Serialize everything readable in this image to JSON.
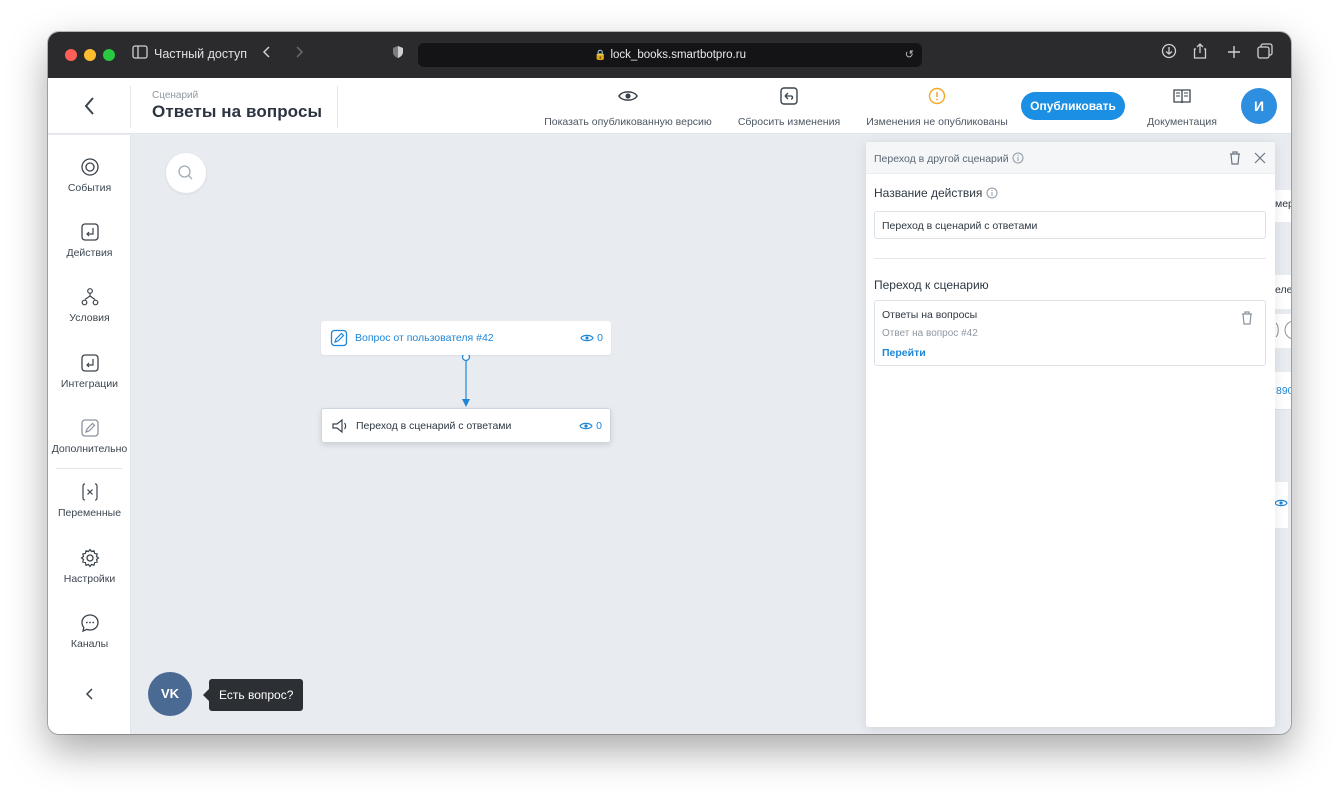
{
  "browser": {
    "tab_label": "Частный доступ",
    "url": "lock_books.smartbotpro.ru"
  },
  "header": {
    "scenario_caption": "Сценарий",
    "scenario_title": "Ответы на вопросы",
    "show_published_label": "Показать опубликованную версию",
    "reset_changes_label": "Сбросить изменения",
    "unpublished_label": "Изменения не опубликованы",
    "publish_label": "Опубликовать",
    "docs_label": "Документация",
    "avatar_initial": "И",
    "warning_color": "#f5a623",
    "accent_color": "#1a8fe3"
  },
  "sidebar": {
    "items": [
      {
        "label": "События",
        "icon": "target-icon"
      },
      {
        "label": "Действия",
        "icon": "action-icon"
      },
      {
        "label": "Условия",
        "icon": "branch-icon"
      },
      {
        "label": "Интеграции",
        "icon": "integration-icon"
      },
      {
        "label": "Дополнительно",
        "icon": "edit-icon"
      },
      {
        "label": "Переменные",
        "icon": "variable-icon"
      },
      {
        "label": "Настройки",
        "icon": "gear-icon"
      },
      {
        "label": "Каналы",
        "icon": "chat-icon"
      }
    ]
  },
  "canvas": {
    "nodes": [
      {
        "label": "Вопрос от пользователя #42",
        "views": "0"
      },
      {
        "label": "Переход в сценарий с ответами",
        "views": "0"
      }
    ],
    "help_tooltip": "Есть вопрос?",
    "vk_label": "VK",
    "peek": {
      "text_1": "мер",
      "text_2": "еле",
      "text_3": "890"
    }
  },
  "panel": {
    "title": "Переход в другой сценарий",
    "action_name_label": "Название действия",
    "action_name_value": "Переход в сценарий с ответами",
    "goto_label": "Переход к сценарию",
    "card": {
      "scenario": "Ответы на вопросы",
      "step": "Ответ на вопрос #42",
      "link": "Перейти"
    }
  }
}
